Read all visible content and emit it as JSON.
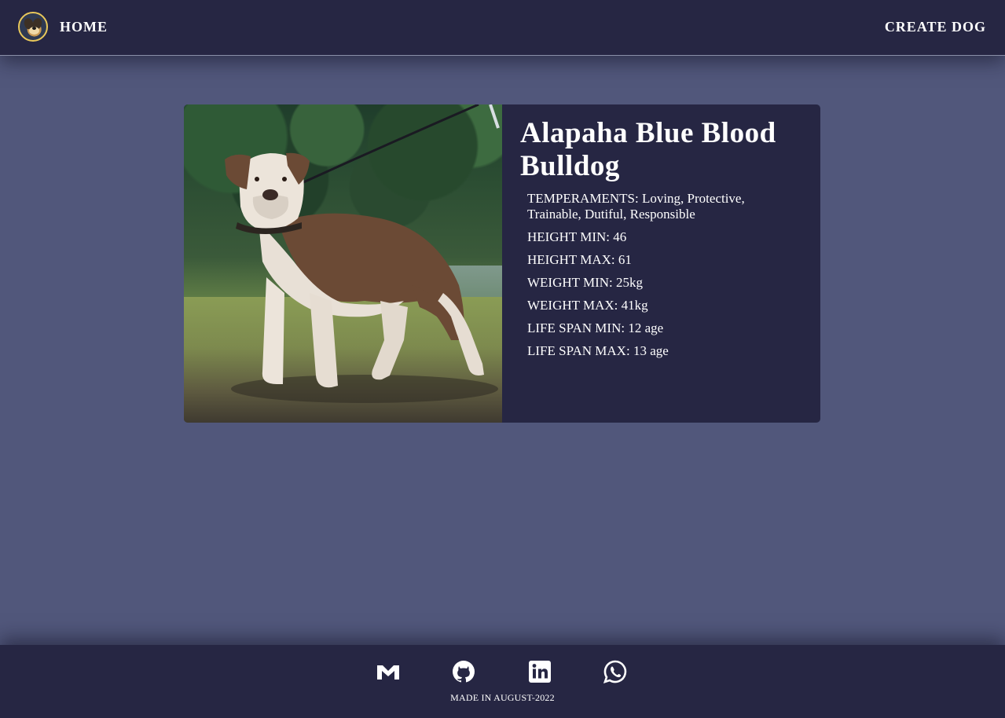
{
  "navbar": {
    "logo_icon": "dog-logo-icon",
    "home_label": "HOME",
    "create_label": "CREATE DOG"
  },
  "dog": {
    "name": "Alapaha Blue Blood Bulldog",
    "image_alt": "brown-and-white-bulldog-photo",
    "attributes": [
      {
        "label": "TEMPERAMENTS",
        "value": "Loving, Protective, Trainable, Dutiful, Responsible"
      },
      {
        "label": "HEIGHT MIN",
        "value": "46"
      },
      {
        "label": "HEIGHT MAX",
        "value": "61"
      },
      {
        "label": "WEIGHT MIN",
        "value": "25kg"
      },
      {
        "label": "WEIGHT MAX",
        "value": "41kg"
      },
      {
        "label": "LIFE SPAN MIN",
        "value": "12 age"
      },
      {
        "label": "LIFE SPAN MAX",
        "value": "13 age"
      }
    ]
  },
  "footer": {
    "icons": [
      "gmail-icon",
      "github-icon",
      "linkedin-icon",
      "whatsapp-icon"
    ],
    "text": "MADE IN AUGUST-2022"
  },
  "colors": {
    "background": "#51577b",
    "panel": "#262643",
    "text": "#ffffff"
  }
}
